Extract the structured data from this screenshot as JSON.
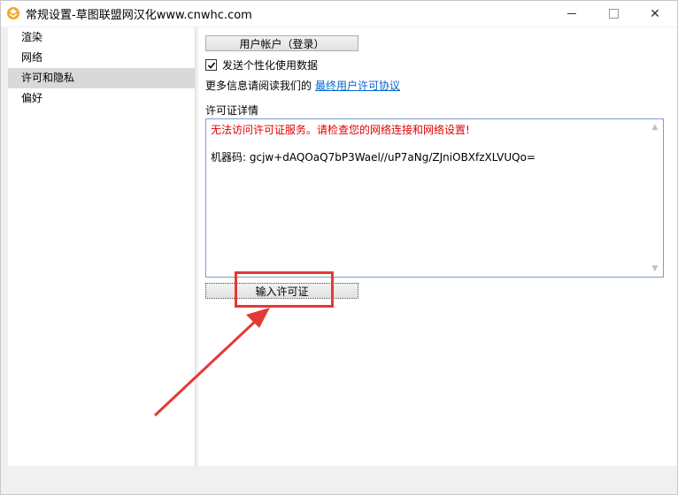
{
  "window": {
    "title": "常规设置-草图联盟网汉化www.cnwhc.com",
    "controls": {
      "minimize": "minimize",
      "maximize": "maximize",
      "close": "✕"
    },
    "icon": "app-logo-icon"
  },
  "sidebar": {
    "items": [
      {
        "label": "渲染",
        "selected": false
      },
      {
        "label": "网络",
        "selected": false
      },
      {
        "label": "许可和隐私",
        "selected": true
      },
      {
        "label": "偏好",
        "selected": false
      }
    ]
  },
  "content": {
    "account_button": "用户帐户（登录）",
    "send_usage": {
      "label": "发送个性化使用数据",
      "checked": true
    },
    "more_info_text": "更多信息请阅读我们的",
    "eula_link": "最终用户许可协议",
    "license_details_label": "许可证详情",
    "license_details": {
      "error": "无法访问许可证服务。请检查您的网络连接和网络设置!",
      "machine_code": "机器码: gcjw+dAQOaQ7bP3Wael//uP7aNg/ZJniOBXfzXLVUQo="
    },
    "enter_license_button": "输入许可证"
  },
  "annotation": {
    "color": "#e53935"
  }
}
